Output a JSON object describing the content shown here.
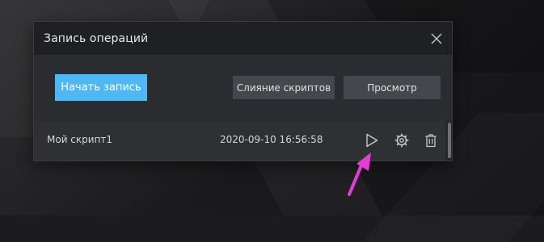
{
  "dialog": {
    "title": "Запись операций",
    "close_icon": "close-icon"
  },
  "toolbar": {
    "record_label": "Начать запись",
    "merge_label": "Слияние скриптов",
    "view_label": "Просмотр"
  },
  "scripts": [
    {
      "name": "Мой скрипт1",
      "date": "2020-09-10 16:56:58",
      "icons": [
        "play-icon",
        "gear-icon",
        "trash-icon"
      ]
    }
  ],
  "colors": {
    "accent": "#4fb7f1",
    "arrow": "#e83bd6",
    "dialog_bg": "#2a2c30",
    "title_bar_bg": "#1f2023",
    "button_bg": "#45474c"
  }
}
